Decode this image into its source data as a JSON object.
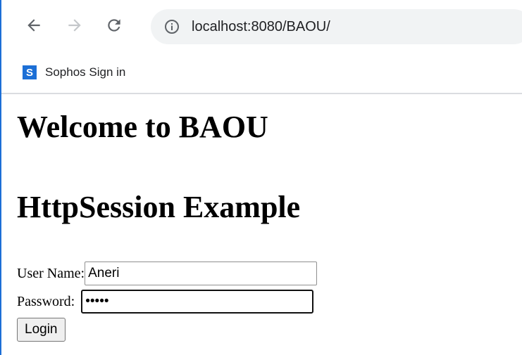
{
  "browser": {
    "url": "localhost:8080/BAOU/",
    "bookmarks": [
      {
        "icon_letter": "S",
        "label": "Sophos Sign in"
      }
    ]
  },
  "page": {
    "heading1": "Welcome to BAOU",
    "heading2": "HttpSession Example",
    "form": {
      "username_label": "User Name:",
      "username_value": "Aneri",
      "password_label": "Password:",
      "password_value": "•••••",
      "login_label": "Login"
    }
  },
  "colors": {
    "accent": "#1c6fd6",
    "omnibox_bg": "#f1f3f4"
  }
}
